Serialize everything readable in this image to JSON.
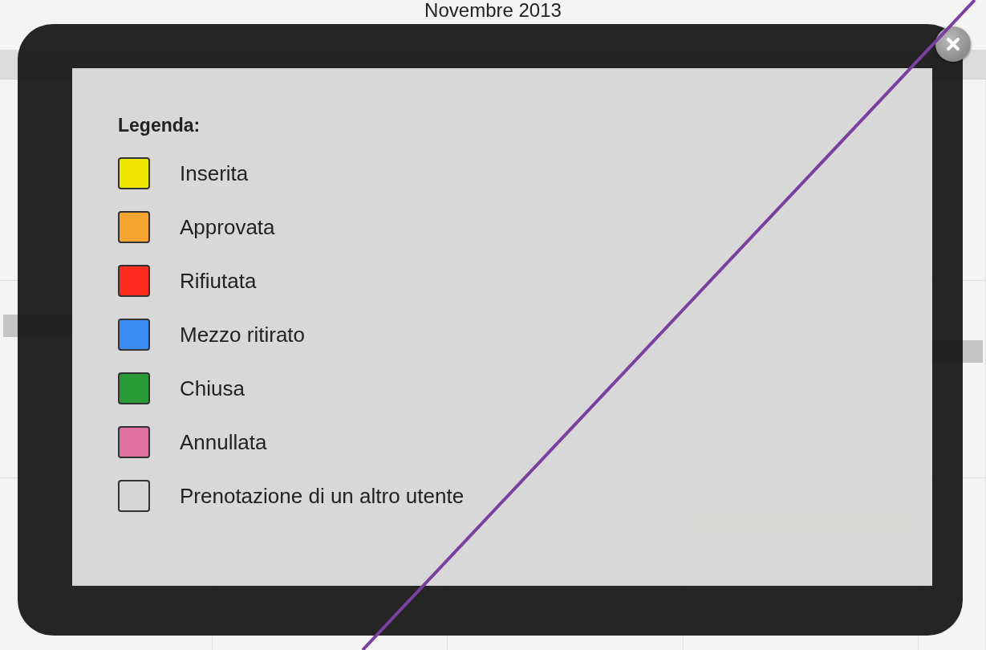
{
  "calendar": {
    "title": "Novembre 2013"
  },
  "legend": {
    "title": "Legenda:",
    "items": [
      {
        "label": "Inserita",
        "color": "#f2e600"
      },
      {
        "label": "Approvata",
        "color": "#f5a431"
      },
      {
        "label": "Rifiutata",
        "color": "#ff2d20"
      },
      {
        "label": "Mezzo ritirato",
        "color": "#3b8cf5"
      },
      {
        "label": "Chiusa",
        "color": "#2a9a37"
      },
      {
        "label": "Annullata",
        "color": "#de71a0"
      },
      {
        "label": "Prenotazione di un altro utente",
        "color": "#d6d6d6"
      }
    ]
  }
}
